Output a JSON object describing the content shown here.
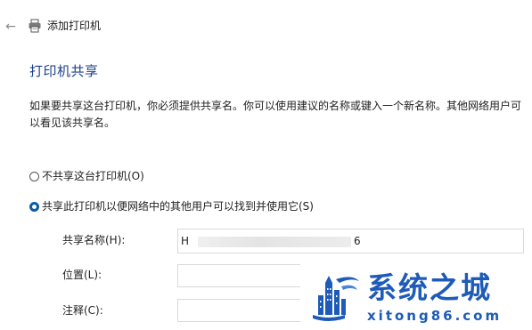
{
  "header": {
    "back_icon": "arrow-left-icon",
    "title_icon": "printer-icon",
    "title": "添加打印机"
  },
  "page": {
    "heading": "打印机共享",
    "description": "如果要共享这台打印机，你必须提供共享名。你可以使用建议的名称或键入一个新名称。其他网络用户可以看见该共享名。"
  },
  "sharing": {
    "option_no_share": "不共享这台打印机(O)",
    "option_share": "共享此打印机以便网络中的其他用户可以找到并使用它(S)",
    "selected": "option_share"
  },
  "form": {
    "share_name_label": "共享名称(H):",
    "share_name_value_start": "H",
    "share_name_value_end": "6",
    "location_label": "位置(L):",
    "location_value": "",
    "comment_label": "注释(C):",
    "comment_value": ""
  },
  "watermark": {
    "title": "系统之城",
    "url": "xitong86.com",
    "color": "#1e5bb8"
  }
}
